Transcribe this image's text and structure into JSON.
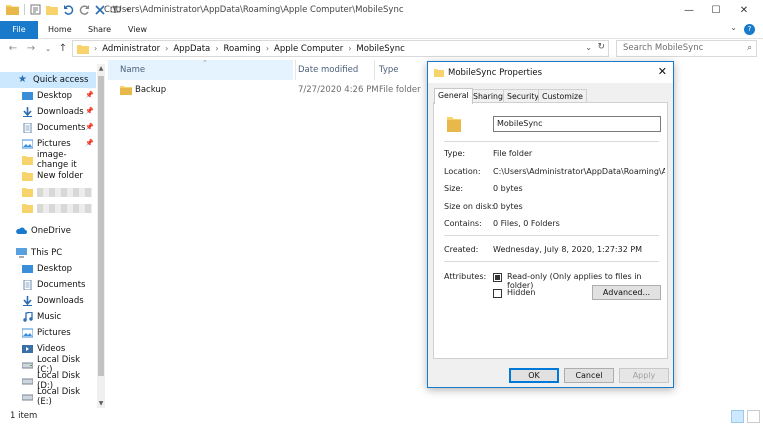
{
  "window": {
    "title_path": "C:\\Users\\Administrator\\AppData\\Roaming\\Apple Computer\\MobileSync",
    "controls": {
      "minimize": "—",
      "maximize": "☐",
      "close": "✕"
    }
  },
  "ribbon": {
    "tabs": [
      "File",
      "Home",
      "Share",
      "View"
    ],
    "help": "?",
    "expand": "⌄"
  },
  "address": {
    "breadcrumbs": [
      "Administrator",
      "AppData",
      "Roaming",
      "Apple Computer",
      "MobileSync"
    ],
    "search_placeholder": "Search MobileSync"
  },
  "nav": {
    "quick_access": "Quick access",
    "quick_items": [
      {
        "label": "Desktop",
        "pinned": true
      },
      {
        "label": "Downloads",
        "pinned": true
      },
      {
        "label": "Documents",
        "pinned": true
      },
      {
        "label": "Pictures",
        "pinned": true
      },
      {
        "label": "image-change it",
        "pinned": false
      },
      {
        "label": "New folder",
        "pinned": false
      }
    ],
    "onedrive": "OneDrive",
    "this_pc": "This PC",
    "pc_items": [
      "Desktop",
      "Documents",
      "Downloads",
      "Music",
      "Pictures",
      "Videos",
      "Local Disk (C:)",
      "Local Disk (D:)",
      "Local Disk (E:)"
    ]
  },
  "filelist": {
    "columns": {
      "name": "Name",
      "date": "Date modified",
      "type": "Type"
    },
    "rows": [
      {
        "name": "Backup",
        "date": "7/27/2020 4:26 PM",
        "type": "File folder"
      }
    ]
  },
  "status": {
    "count": "1 item"
  },
  "dialog": {
    "title": "MobileSync Properties",
    "tabs": [
      "General",
      "Sharing",
      "Security",
      "Customize"
    ],
    "name_value": "MobileSync",
    "props": {
      "type_label": "Type:",
      "type_value": "File folder",
      "location_label": "Location:",
      "location_value": "C:\\Users\\Administrator\\AppData\\Roaming\\Apple Ca",
      "size_label": "Size:",
      "size_value": "0 bytes",
      "size_on_disk_label": "Size on disk:",
      "size_on_disk_value": "0 bytes",
      "contains_label": "Contains:",
      "contains_value": "0 Files, 0 Folders",
      "created_label": "Created:",
      "created_value": "Wednesday, July 8, 2020, 1:27:32 PM",
      "attributes_label": "Attributes:"
    },
    "readonly_label": "Read-only (Only applies to files in folder)",
    "hidden_label": "Hidden",
    "advanced_label": "Advanced...",
    "ok": "OK",
    "cancel": "Cancel",
    "apply": "Apply"
  },
  "colors": {
    "accent": "#1979ca",
    "folder": "#f8d26b",
    "selected": "#cce8ff"
  }
}
